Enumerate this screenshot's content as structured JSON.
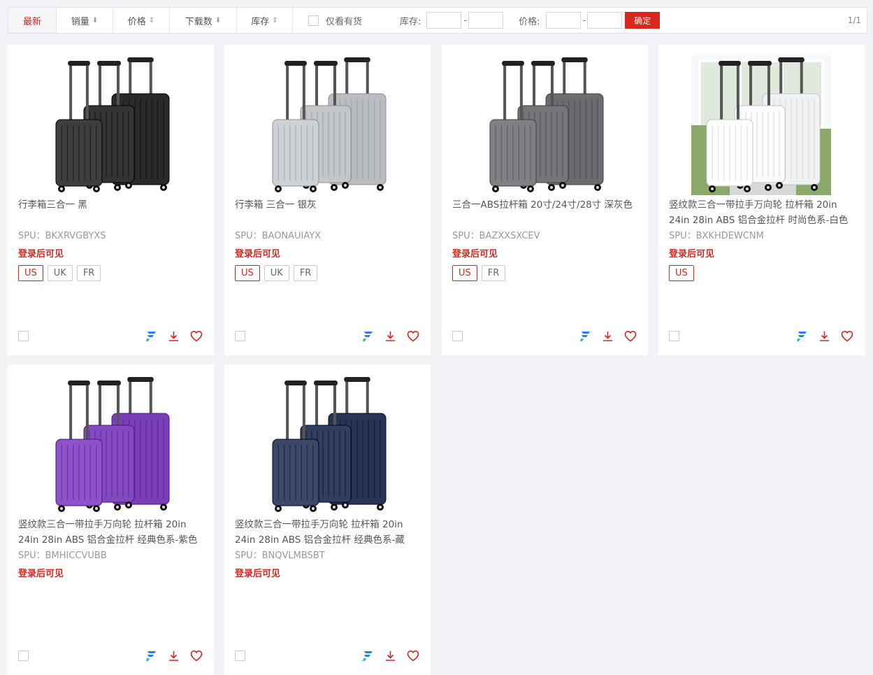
{
  "toolbar": {
    "sort_tabs": [
      {
        "label": "最新",
        "arrow": ""
      },
      {
        "label": "销量",
        "arrow": "⬇"
      },
      {
        "label": "价格",
        "arrow": "⇕"
      },
      {
        "label": "下载数",
        "arrow": "⬇"
      },
      {
        "label": "库存",
        "arrow": "⇕"
      }
    ],
    "only_in_stock": "仅看有货",
    "stock_label": "库存:",
    "price_label": "价格:",
    "dash": "-",
    "confirm": "确定",
    "pager": "1/1"
  },
  "colors": {
    "accent": "#d7261e",
    "brand_blue": "#2f7bf5"
  },
  "products": [
    {
      "title": "行李箱三合一 黑",
      "spu": "SPU：BKXRVGBYXS",
      "price": "登录后可见",
      "sites": [
        "US",
        "UK",
        "FR"
      ],
      "color": "#2a2a2c",
      "style": "ribbed"
    },
    {
      "title": "行李箱 三合一 银灰",
      "spu": "SPU：BAONAUIAYX",
      "price": "登录后可见",
      "sites": [
        "US",
        "UK",
        "FR"
      ],
      "color": "#b9bcc0",
      "style": "ribbed"
    },
    {
      "title": "三合一ABS拉杆箱 20寸/24寸/28寸 深灰色",
      "spu": "SPU：BAZXXSXCEV",
      "price": "登录后可见",
      "sites": [
        "US",
        "FR"
      ],
      "color": "#6a6c70",
      "style": "ribbed"
    },
    {
      "title": "竖纹款三合一带拉手万向轮 拉杆箱 20in 24in 28in ABS 铝合金拉杆 时尚色系-白色 …",
      "spu": "SPU：BXKHDEWCNM",
      "price": "登录后可见",
      "sites": [
        "US"
      ],
      "color": "#f1f2f4",
      "style": "room"
    },
    {
      "title": "竖纹款三合一带拉手万向轮 拉杆箱 20in 24in 28in ABS 铝合金拉杆 经典色系-紫色 …",
      "spu": "SPU：BMHICCVUBB",
      "price": "登录后可见",
      "sites": [],
      "color": "#7a3fb5",
      "style": "ribbed"
    },
    {
      "title": "竖纹款三合一带拉手万向轮 拉杆箱 20in 24in 28in ABS 铝合金拉杆 经典色系-藏青…",
      "spu": "SPU：BNQVLMBSBT",
      "price": "登录后可见",
      "sites": [],
      "color": "#283453",
      "style": "ribbed"
    }
  ]
}
